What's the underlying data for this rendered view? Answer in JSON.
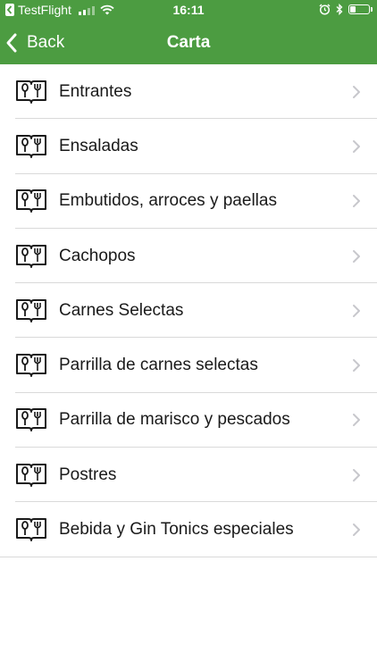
{
  "status_bar": {
    "carrier": "TestFlight",
    "time": "16:11"
  },
  "nav": {
    "back_label": "Back",
    "title": "Carta"
  },
  "menu": {
    "items": [
      {
        "label": "Entrantes"
      },
      {
        "label": "Ensaladas"
      },
      {
        "label": "Embutidos, arroces y paellas"
      },
      {
        "label": "Cachopos"
      },
      {
        "label": "Carnes Selectas"
      },
      {
        "label": "Parrilla de carnes selectas"
      },
      {
        "label": "Parrilla de marisco y pescados"
      },
      {
        "label": "Postres"
      },
      {
        "label": "Bebida y Gin Tonics especiales"
      }
    ],
    "item_icon": "menu-book-cutlery-icon",
    "chevron_icon": "chevron-right-icon"
  },
  "colors": {
    "header": "#4c9c41",
    "header_text": "#ffffff",
    "separator": "#d9d9d9",
    "chevron": "#c7c7cc"
  }
}
